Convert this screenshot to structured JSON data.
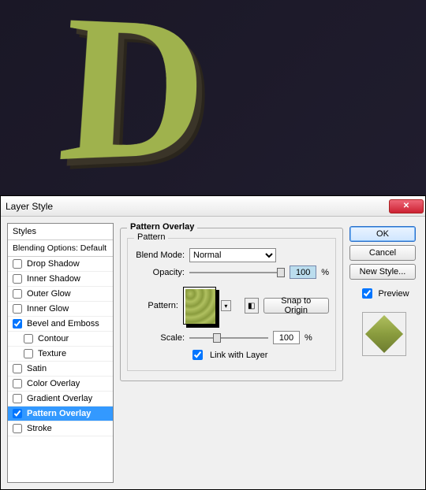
{
  "dialog": {
    "title": "Layer Style"
  },
  "styles": {
    "header": "Styles",
    "blending": "Blending Options: Default",
    "items": [
      {
        "label": "Drop Shadow",
        "checked": false,
        "sub": false
      },
      {
        "label": "Inner Shadow",
        "checked": false,
        "sub": false
      },
      {
        "label": "Outer Glow",
        "checked": false,
        "sub": false
      },
      {
        "label": "Inner Glow",
        "checked": false,
        "sub": false
      },
      {
        "label": "Bevel and Emboss",
        "checked": true,
        "sub": false
      },
      {
        "label": "Contour",
        "checked": false,
        "sub": true
      },
      {
        "label": "Texture",
        "checked": false,
        "sub": true
      },
      {
        "label": "Satin",
        "checked": false,
        "sub": false
      },
      {
        "label": "Color Overlay",
        "checked": false,
        "sub": false
      },
      {
        "label": "Gradient Overlay",
        "checked": false,
        "sub": false
      },
      {
        "label": "Pattern Overlay",
        "checked": true,
        "sub": false,
        "selected": true
      },
      {
        "label": "Stroke",
        "checked": false,
        "sub": false
      }
    ]
  },
  "pattern_overlay": {
    "group_label": "Pattern Overlay",
    "inner_label": "Pattern",
    "blend_mode_label": "Blend Mode:",
    "blend_mode_value": "Normal",
    "opacity_label": "Opacity:",
    "opacity_value": "100",
    "opacity_unit": "%",
    "pattern_label": "Pattern:",
    "snap_label": "Snap to Origin",
    "scale_label": "Scale:",
    "scale_value": "100",
    "scale_unit": "%",
    "link_label": "Link with Layer",
    "link_checked": true
  },
  "buttons": {
    "ok": "OK",
    "cancel": "Cancel",
    "new_style": "New Style...",
    "preview": "Preview",
    "preview_checked": true
  }
}
